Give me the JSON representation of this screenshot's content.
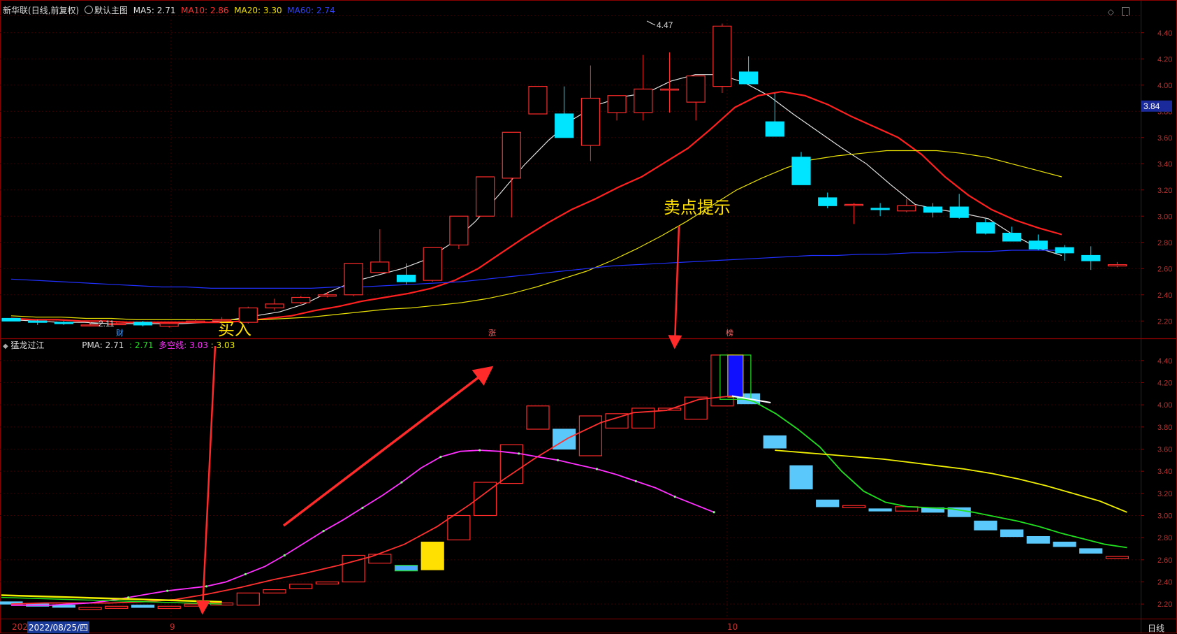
{
  "colors": {
    "background": "#000000",
    "frame": "#8b0000",
    "grid": "#3a0000",
    "axis_text": "#c03030",
    "up": "#ff2a2a",
    "down": "#00e5ff",
    "down_lower": "#5ac8fa",
    "ma5": "#e0e0e0",
    "ma10": "#ff2020",
    "ma20": "#e8e000",
    "ma60": "#2030ff",
    "annotation": "#ffe000",
    "arrow": "#ff2a2a",
    "pma": "#ff3030",
    "green_line": "#20e020",
    "magenta_line": "#ff30ff",
    "yellow_line": "#f0f000"
  },
  "header": {
    "stock_name": "新华联",
    "period": "(日线,前复权)",
    "template": "默认主图",
    "ma5_label": "MA5:",
    "ma5_value": "2.71",
    "ma10_label": "MA10:",
    "ma10_value": "2.86",
    "ma20_label": "MA20:",
    "ma20_value": "3.30",
    "ma60_label": "MA60:",
    "ma60_value": "2.74"
  },
  "sub_header": {
    "indicator": "猛龙过江",
    "pma_label": "PMA:",
    "pma_value": "2.71",
    "green_value": ": 2.71",
    "dk_label": "多空线:",
    "dk_value": "3.03",
    "yellow_value": ": 3.03"
  },
  "annotations": {
    "buy": "买入",
    "sell": "卖点提示",
    "max_label": "4.47",
    "min_label": "2.11",
    "price_tag": "3.84",
    "event_cai": "财",
    "event_zhang": "涨",
    "event_bang": "榜"
  },
  "footer": {
    "date_prefix": "202",
    "date": "2022/08/25/四",
    "month_9": "9",
    "month_10": "10",
    "period_label": "日线"
  },
  "chart_data": [
    {
      "type": "candlestick",
      "title": "新华联 (日线,前复权)",
      "ylim": [
        2.1,
        4.5
      ],
      "yticks": [
        2.2,
        2.4,
        2.6,
        2.8,
        3.0,
        3.2,
        3.4,
        3.6,
        3.8,
        4.0,
        4.2,
        4.4
      ],
      "ohlc": [
        [
          2.22,
          2.22,
          2.2,
          2.2
        ],
        [
          2.2,
          2.21,
          2.17,
          2.19
        ],
        [
          2.19,
          2.2,
          2.17,
          2.18
        ],
        [
          2.17,
          2.19,
          2.16,
          2.17
        ],
        [
          2.18,
          2.19,
          2.17,
          2.18
        ],
        [
          2.19,
          2.2,
          2.16,
          2.17
        ],
        [
          2.16,
          2.19,
          2.15,
          2.18
        ],
        [
          2.2,
          2.21,
          2.19,
          2.2
        ],
        [
          2.21,
          2.23,
          2.11,
          2.21
        ],
        [
          2.19,
          2.31,
          2.18,
          2.3
        ],
        [
          2.3,
          2.37,
          2.28,
          2.33
        ],
        [
          2.34,
          2.39,
          2.33,
          2.38
        ],
        [
          2.39,
          2.42,
          2.38,
          2.4
        ],
        [
          2.4,
          2.64,
          2.39,
          2.64
        ],
        [
          2.57,
          2.9,
          2.57,
          2.65
        ],
        [
          2.55,
          2.64,
          2.48,
          2.5
        ],
        [
          2.51,
          2.76,
          2.5,
          2.76
        ],
        [
          2.78,
          3.0,
          2.75,
          3.0
        ],
        [
          3.0,
          3.3,
          3.0,
          3.3
        ],
        [
          3.29,
          3.63,
          2.99,
          3.64
        ],
        [
          3.78,
          3.99,
          3.78,
          3.99
        ],
        [
          3.78,
          3.99,
          3.6,
          3.6
        ],
        [
          3.54,
          4.15,
          3.42,
          3.9
        ],
        [
          3.79,
          3.92,
          3.73,
          3.92
        ],
        [
          3.79,
          4.23,
          3.73,
          3.97
        ],
        [
          3.97,
          4.25,
          3.79,
          3.97
        ],
        [
          3.87,
          4.07,
          3.73,
          4.07
        ],
        [
          3.99,
          4.47,
          3.94,
          4.45
        ],
        [
          4.1,
          4.22,
          4.01,
          4.01
        ],
        [
          3.72,
          3.94,
          3.61,
          3.61
        ],
        [
          3.45,
          3.49,
          3.24,
          3.24
        ],
        [
          3.14,
          3.18,
          3.06,
          3.08
        ],
        [
          3.08,
          3.1,
          2.94,
          3.09
        ],
        [
          3.06,
          3.1,
          3.0,
          3.05
        ],
        [
          3.04,
          3.13,
          3.03,
          3.08
        ],
        [
          3.07,
          3.1,
          2.99,
          3.03
        ],
        [
          3.07,
          3.17,
          2.98,
          2.99
        ],
        [
          2.95,
          2.98,
          2.86,
          2.87
        ],
        [
          2.87,
          2.92,
          2.81,
          2.81
        ],
        [
          2.81,
          2.86,
          2.74,
          2.75
        ],
        [
          2.76,
          2.78,
          2.66,
          2.72
        ],
        [
          2.7,
          2.77,
          2.59,
          2.66
        ],
        [
          2.62,
          2.65,
          2.61,
          2.63
        ]
      ],
      "series": [
        {
          "name": "MA5",
          "values": [
            2.21,
            2.2,
            2.19,
            2.19,
            2.18,
            2.18,
            2.18,
            2.18,
            2.19,
            2.21,
            2.24,
            2.27,
            2.33,
            2.42,
            2.5,
            2.55,
            2.6,
            2.67,
            2.79,
            2.96,
            3.17,
            3.39,
            3.58,
            3.74,
            3.85,
            3.91,
            3.94,
            4.03,
            4.08,
            4.08,
            4.02,
            3.92,
            3.78,
            3.65,
            3.52,
            3.4,
            3.24,
            3.09,
            3.05,
            3.02,
            2.98,
            2.86,
            2.76,
            2.7
          ]
        },
        {
          "name": "MA10",
          "values": [
            2.22,
            2.21,
            2.21,
            2.2,
            2.2,
            2.19,
            2.19,
            2.19,
            2.19,
            2.19,
            2.2,
            2.22,
            2.24,
            2.28,
            2.31,
            2.35,
            2.38,
            2.41,
            2.45,
            2.51,
            2.6,
            2.72,
            2.84,
            2.95,
            3.05,
            3.13,
            3.22,
            3.3,
            3.41,
            3.52,
            3.67,
            3.83,
            3.92,
            3.95,
            3.92,
            3.85,
            3.76,
            3.68,
            3.6,
            3.47,
            3.3,
            3.16,
            3.05,
            2.97,
            2.91,
            2.86
          ]
        },
        {
          "name": "MA20",
          "values": [
            2.24,
            2.23,
            2.23,
            2.22,
            2.22,
            2.21,
            2.21,
            2.21,
            2.21,
            2.21,
            2.21,
            2.22,
            2.23,
            2.25,
            2.27,
            2.29,
            2.3,
            2.32,
            2.34,
            2.37,
            2.41,
            2.46,
            2.52,
            2.58,
            2.66,
            2.75,
            2.85,
            2.96,
            3.08,
            3.2,
            3.29,
            3.37,
            3.43,
            3.46,
            3.48,
            3.5,
            3.5,
            3.5,
            3.48,
            3.45,
            3.4,
            3.35,
            3.3
          ]
        },
        {
          "name": "MA60",
          "values": [
            2.52,
            2.51,
            2.5,
            2.49,
            2.48,
            2.47,
            2.46,
            2.46,
            2.45,
            2.45,
            2.45,
            2.45,
            2.45,
            2.46,
            2.46,
            2.47,
            2.48,
            2.49,
            2.5,
            2.52,
            2.54,
            2.56,
            2.58,
            2.6,
            2.62,
            2.63,
            2.64,
            2.65,
            2.66,
            2.67,
            2.68,
            2.69,
            2.7,
            2.7,
            2.71,
            2.71,
            2.72,
            2.72,
            2.73,
            2.73,
            2.74,
            2.74,
            2.74
          ]
        }
      ]
    },
    {
      "type": "bar",
      "title": "猛龙过江",
      "ylim": [
        2.1,
        4.5
      ],
      "yticks": [
        2.2,
        2.4,
        2.6,
        2.8,
        3.0,
        3.2,
        3.4,
        3.6,
        3.8,
        4.0,
        4.2,
        4.4
      ],
      "series": [
        {
          "name": "PMA",
          "values": [
            2.2,
            2.21,
            2.21,
            2.21,
            2.22,
            2.24,
            2.29,
            2.35,
            2.42,
            2.48,
            2.55,
            2.63,
            2.74,
            2.9,
            3.1,
            3.32,
            3.52,
            3.7,
            3.84,
            3.93,
            3.95,
            4.05,
            4.08
          ]
        },
        {
          "name": "多空线",
          "values": [
            2.19,
            2.19,
            2.19,
            2.2,
            2.21,
            2.23,
            2.26,
            2.29,
            2.32,
            2.34,
            2.36,
            2.4,
            2.47,
            2.54,
            2.64,
            2.75,
            2.86,
            2.96,
            3.07,
            3.18,
            3.3,
            3.43,
            3.53,
            3.58,
            3.59,
            3.58,
            3.56,
            3.53,
            3.5,
            3.46,
            3.42,
            3.37,
            3.31,
            3.25,
            3.17,
            3.1,
            3.03
          ]
        }
      ]
    }
  ]
}
